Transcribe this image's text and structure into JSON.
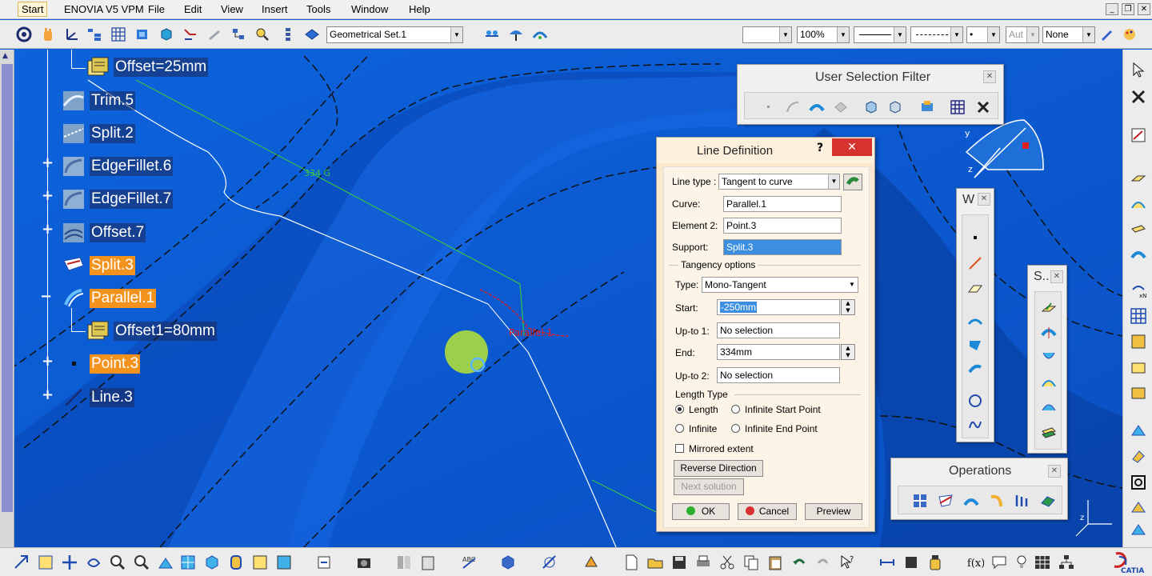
{
  "menu": {
    "items": [
      "Start",
      "ENOVIA V5 VPM",
      "File",
      "Edit",
      "View",
      "Insert",
      "Tools",
      "Window",
      "Help"
    ]
  },
  "toolbar_top": {
    "geometrical_set": "Geometrical Set.1",
    "zoom": "100%",
    "aut": "Aut",
    "none": "None"
  },
  "tree": {
    "items": [
      {
        "label": "Offset=25mm",
        "highlight": false,
        "icon": "offset-icon"
      },
      {
        "label": "Trim.5",
        "highlight": false,
        "icon": "trim-icon"
      },
      {
        "label": "Split.2",
        "highlight": false,
        "icon": "split-icon"
      },
      {
        "label": "EdgeFillet.6",
        "highlight": false,
        "icon": "edgefillet-icon"
      },
      {
        "label": "EdgeFillet.7",
        "highlight": false,
        "icon": "edgefillet-icon"
      },
      {
        "label": "Offset.7",
        "highlight": false,
        "icon": "offset-surface-icon"
      },
      {
        "label": "Split.3",
        "highlight": true,
        "icon": "split-icon"
      },
      {
        "label": "Parallel.1",
        "highlight": true,
        "icon": "parallel-curve-icon"
      },
      {
        "label": "Offset1=80mm",
        "highlight": false,
        "icon": "offset-icon"
      },
      {
        "label": "Point.3",
        "highlight": true,
        "icon": "point-icon"
      },
      {
        "label": "Line.3",
        "highlight": false,
        "icon": "line-icon"
      }
    ]
  },
  "viewport": {
    "annotation_1": "334 G",
    "annotation_2": "Parallel.1"
  },
  "user_selection_filter": {
    "title": "User Selection Filter"
  },
  "w_toolbar": {
    "title": "W"
  },
  "s_toolbar": {
    "title": "S.."
  },
  "operations": {
    "title": "Operations"
  },
  "dialog": {
    "title": "Line Definition",
    "help": "?",
    "close": "✕",
    "line_type_label": "Line type :",
    "line_type": "Tangent to curve",
    "curve_label": "Curve:",
    "curve": "Parallel.1",
    "element2_label": "Element 2:",
    "element2": "Point.3",
    "support_label": "Support:",
    "support": "Split.3",
    "tangency_options": "Tangency options",
    "type_label": "Type:",
    "type": "Mono-Tangent",
    "start_label": "Start:",
    "start": "-250mm",
    "upto1_label": "Up-to 1:",
    "upto1": "No selection",
    "end_label": "End:",
    "end": "334mm",
    "upto2_label": "Up-to 2:",
    "upto2": "No selection",
    "length_type": "Length Type",
    "radio_length": "Length",
    "radio_infinite_start": "Infinite Start Point",
    "radio_infinite": "Infinite",
    "radio_infinite_end": "Infinite End Point",
    "mirrored_extent": "Mirrored extent",
    "reverse_direction": "Reverse Direction",
    "next_solution": "Next solution",
    "ok": "OK",
    "cancel": "Cancel",
    "preview": "Preview"
  },
  "colors": {
    "viewport_blue": "#0b5fd6",
    "tree_highlight": "#f4921e",
    "dialog_bg": "#fbe9cf",
    "close_red": "#d6322e"
  }
}
